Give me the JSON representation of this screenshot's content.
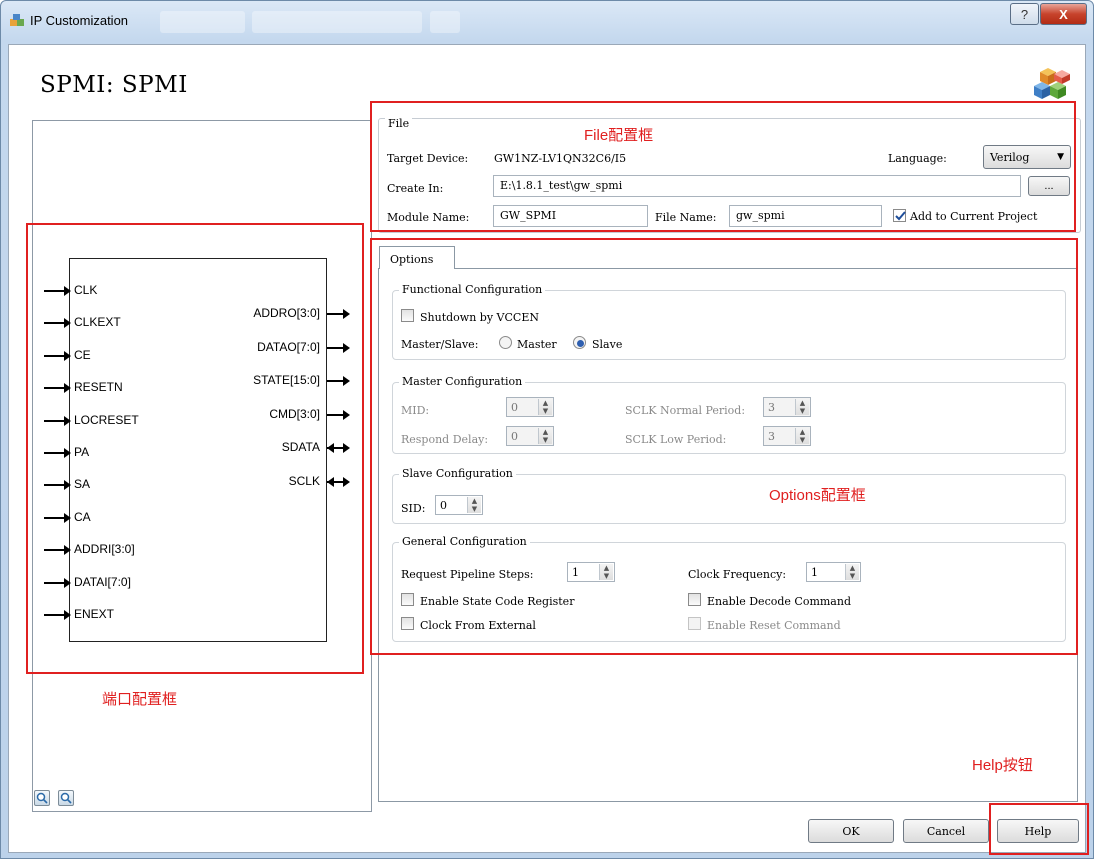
{
  "window": {
    "title": "IP Customization",
    "help_sys_glyph": "?",
    "close_sys_glyph": "X",
    "app_icon": "ip-customization-icon"
  },
  "heading": "SPMI: SPMI",
  "ports": {
    "inputs": [
      "CLK",
      "CLKEXT",
      "CE",
      "RESETN",
      "LOCRESET",
      "PA",
      "SA",
      "CA",
      "ADDRI[3:0]",
      "DATAI[7:0]",
      "ENEXT"
    ],
    "outputs": [
      "ADDRO[3:0]",
      "DATAO[7:0]",
      "STATE[15:0]",
      "CMD[3:0]"
    ],
    "inouts": [
      "SDATA",
      "SCLK"
    ]
  },
  "file": {
    "section_title": "File",
    "target_device_label": "Target Device:",
    "target_device_value": "GW1NZ-LV1QN32C6/I5",
    "language_label": "Language:",
    "language_value": "Verilog",
    "create_in_label": "Create In:",
    "create_in_value": "E:\\1.8.1_test\\gw_spmi",
    "browse_label": "...",
    "module_name_label": "Module Name:",
    "module_name_value": "GW_SPMI",
    "file_name_label": "File Name:",
    "file_name_value": "gw_spmi",
    "add_to_project_label": "Add to Current Project",
    "add_to_project_checked": true
  },
  "options": {
    "tab_label": "Options",
    "functional": {
      "title": "Functional Configuration",
      "shutdown_label": "Shutdown by VCCEN",
      "shutdown_checked": false,
      "master_slave_label": "Master/Slave:",
      "master_label": "Master",
      "slave_label": "Slave",
      "selected": "Slave"
    },
    "master": {
      "title": "Master Configuration",
      "mid_label": "MID:",
      "mid_value": "0",
      "respond_delay_label": "Respond Delay:",
      "respond_delay_value": "0",
      "sclk_normal_label": "SCLK Normal Period:",
      "sclk_normal_value": "3",
      "sclk_low_label": "SCLK Low Period:",
      "sclk_low_value": "3"
    },
    "slave": {
      "title": "Slave Configuration",
      "sid_label": "SID:",
      "sid_value": "0"
    },
    "general": {
      "title": "General Configuration",
      "pipeline_label": "Request Pipeline Steps:",
      "pipeline_value": "1",
      "clock_freq_label": "Clock Frequency:",
      "clock_freq_value": "1",
      "state_code_label": "Enable State Code Register",
      "decode_cmd_label": "Enable Decode Command",
      "clock_external_label": "Clock From External",
      "reset_cmd_label": "Enable Reset Command"
    }
  },
  "buttons": {
    "ok": "OK",
    "cancel": "Cancel",
    "help": "Help"
  },
  "annotations": {
    "file_box": "File配置框",
    "options_box": "Options配置框",
    "port_box": "端口配置框",
    "help_button": "Help按钮",
    "color": "#e02020"
  }
}
